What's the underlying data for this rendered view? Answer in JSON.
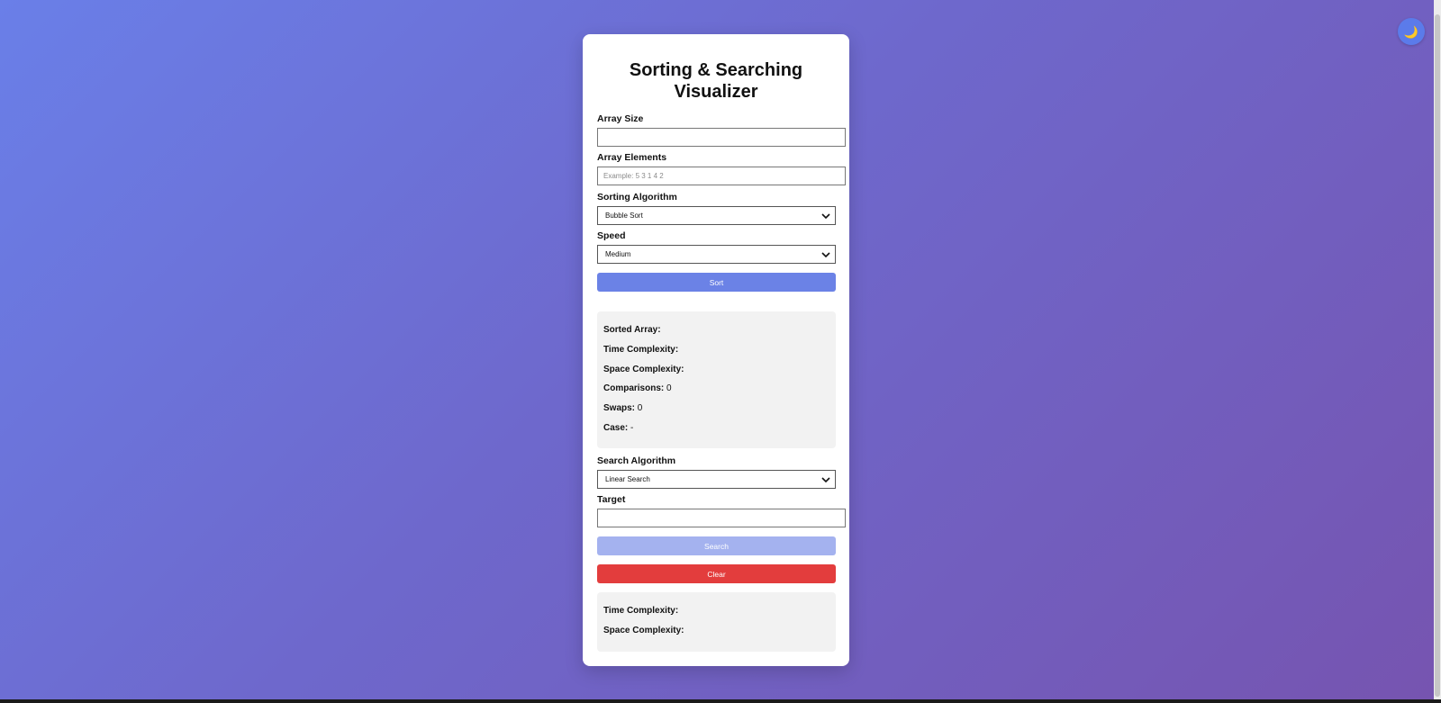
{
  "theme_toggle": {
    "icon": "moon-icon",
    "glyph": "🌙"
  },
  "title": {
    "line1": "Sorting & Searching",
    "line2": "Visualizer"
  },
  "array_size": {
    "label": "Array Size",
    "value": "",
    "placeholder": ""
  },
  "array_elements": {
    "label": "Array Elements",
    "value": "",
    "placeholder": "Example: 5 3 1 4 2"
  },
  "sorting_algorithm": {
    "label": "Sorting Algorithm",
    "selected": "Bubble Sort"
  },
  "speed": {
    "label": "Speed",
    "selected": "Medium"
  },
  "sort_button": {
    "label": "Sort"
  },
  "sort_results": {
    "sorted_array": {
      "label": "Sorted Array:",
      "value": ""
    },
    "time_complexity": {
      "label": "Time Complexity:",
      "value": ""
    },
    "space_complexity": {
      "label": "Space Complexity:",
      "value": ""
    },
    "comparisons": {
      "label": "Comparisons:",
      "value": "0"
    },
    "swaps": {
      "label": "Swaps:",
      "value": "0"
    },
    "case": {
      "label": "Case:",
      "value": "-"
    }
  },
  "search_algorithm": {
    "label": "Search Algorithm",
    "selected": "Linear Search"
  },
  "target": {
    "label": "Target",
    "value": "",
    "placeholder": ""
  },
  "search_button": {
    "label": "Search"
  },
  "clear_button": {
    "label": "Clear"
  },
  "search_results": {
    "time_complexity": {
      "label": "Time Complexity:",
      "value": ""
    },
    "space_complexity": {
      "label": "Space Complexity:",
      "value": ""
    }
  },
  "colors": {
    "sort_button": "#6b82e6",
    "search_button": "#a4b2ef",
    "clear_button": "#e33d3d",
    "toggle": "#5b7bea"
  }
}
